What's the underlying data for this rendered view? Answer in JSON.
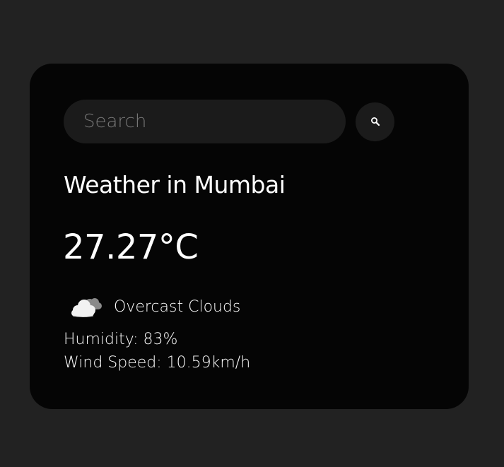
{
  "search": {
    "placeholder": "Search",
    "value": "",
    "button_icon": "search-icon"
  },
  "weather": {
    "title": "Weather in Mumbai",
    "temperature": "27.27°C",
    "icon": "overcast-cloud-icon",
    "description": "Overcast Clouds",
    "humidity": "Humidity: 83%",
    "wind_speed": "Wind Speed: 10.59km/h"
  },
  "colors": {
    "page_background": "#222222",
    "card_background": "#050505",
    "input_background": "#1b1b1b",
    "text": "#ffffff",
    "placeholder": "#777777"
  }
}
